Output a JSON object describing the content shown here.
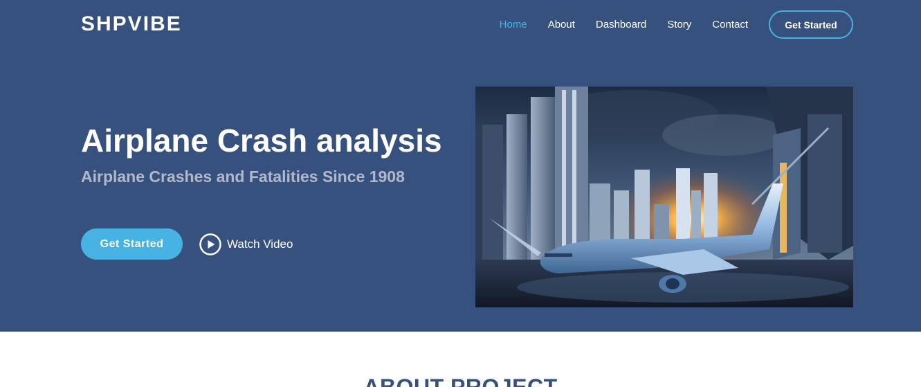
{
  "brand": {
    "logo": "SHPVIBE"
  },
  "nav": {
    "items": [
      {
        "label": "Home",
        "active": true
      },
      {
        "label": "About",
        "active": false
      },
      {
        "label": "Dashboard",
        "active": false
      },
      {
        "label": "Story",
        "active": false
      },
      {
        "label": "Contact",
        "active": false
      }
    ],
    "cta_label": "Get Started"
  },
  "hero": {
    "title": "Airplane Crash analysis",
    "subtitle": "Airplane Crashes and Fatalities Since 1908",
    "primary_button": "Get Started",
    "video_button": "Watch Video",
    "image_icon": "airplane-crash-cityscape-image"
  },
  "about": {
    "title": "ABOUT PROJECT"
  },
  "colors": {
    "hero_bg": "#37517e",
    "accent": "#47b2e4",
    "white": "#ffffff"
  }
}
